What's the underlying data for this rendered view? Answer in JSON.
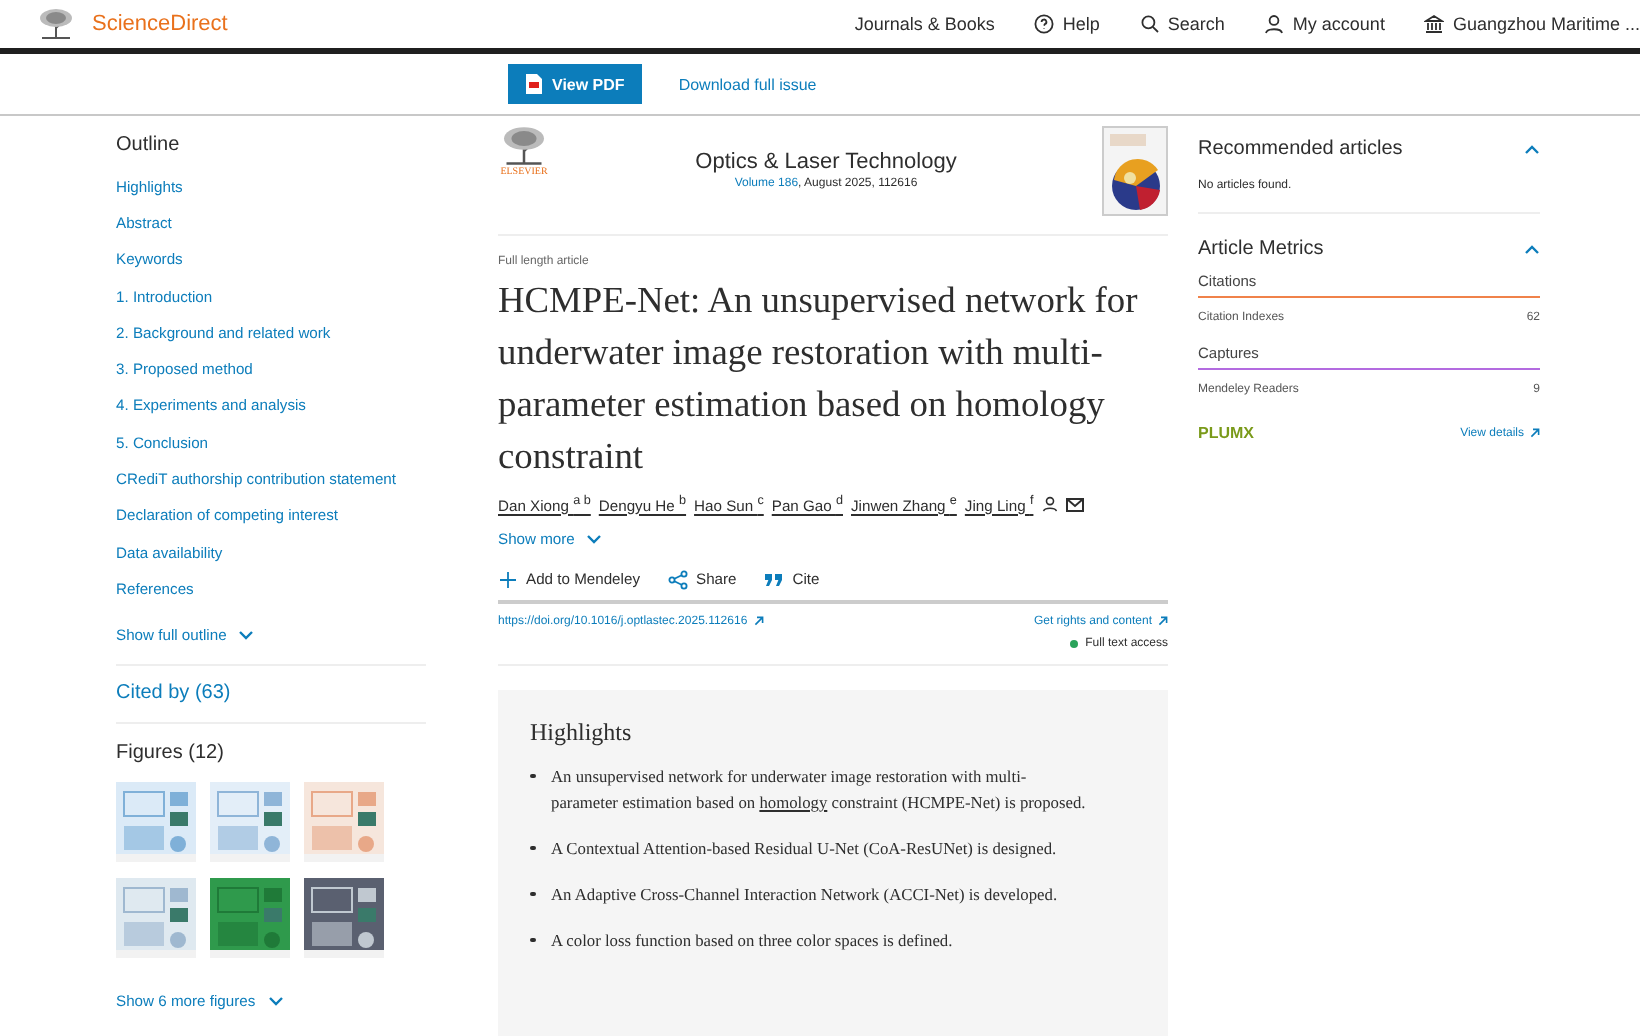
{
  "header": {
    "brand": "ScienceDirect",
    "nav": [
      {
        "kind": "text",
        "label": "Journals & Books"
      },
      {
        "kind": "help",
        "label": "Help"
      },
      {
        "kind": "search",
        "label": "Search"
      },
      {
        "kind": "account",
        "label": "My account"
      },
      {
        "kind": "institution",
        "label": "Guangzhou Maritime ..."
      }
    ]
  },
  "toolbar": {
    "view_pdf": "View PDF",
    "download": "Download full issue"
  },
  "outline": {
    "title": "Outline",
    "items": [
      "Highlights",
      "Abstract",
      "Keywords",
      "1. Introduction",
      "2. Background and related work",
      "3. Proposed method",
      "4. Experiments and analysis",
      "5. Conclusion",
      "CRediT authorship contribution statement",
      "Declaration of competing interest",
      "Data availability",
      "References"
    ],
    "show_full": "Show full outline"
  },
  "cited_by": "Cited by (63)",
  "figures": {
    "title": "Figures (12)",
    "show_more": "Show 6 more figures"
  },
  "journal": {
    "publisher": "ELSEVIER",
    "name": "Optics & Laser Technology",
    "volume_link": "Volume 186",
    "issue_info": ", August 2025, 112616"
  },
  "article": {
    "type": "Full length article",
    "title": "HCMPE-Net: An unsupervised network for underwater image restoration with multi-parameter estimation based on homology constraint",
    "authors": [
      {
        "name": "Dan Xiong",
        "sup": "a b"
      },
      {
        "name": "Dengyu He",
        "sup": "b"
      },
      {
        "name": "Hao Sun",
        "sup": "c"
      },
      {
        "name": "Pan Gao",
        "sup": "d"
      },
      {
        "name": "Jinwen Zhang",
        "sup": "e"
      },
      {
        "name": "Jing Ling",
        "sup": "f",
        "corresponding": true
      }
    ],
    "show_more": "Show more",
    "actions": [
      {
        "kind": "add",
        "label": "Add to Mendeley"
      },
      {
        "kind": "share",
        "label": "Share"
      },
      {
        "kind": "cite",
        "label": "Cite"
      }
    ],
    "doi": "https://doi.org/10.1016/j.optlastec.2025.112616",
    "rights": "Get rights and content",
    "access": "Full text access"
  },
  "highlights": {
    "title": "Highlights",
    "items": [
      {
        "before": "An unsupervised network for underwater image restoration with multi-parameter estimation based on ",
        "link": "homology",
        "after": " constraint (HCMPE-Net) is proposed."
      },
      {
        "before": "A Contextual Attention-based Residual U-Net (CoA-ResUNet) is designed."
      },
      {
        "before": "An Adaptive Cross-Channel Interaction Network (ACCI-Net) is developed."
      },
      {
        "before": "A color loss function based on three color spaces is defined."
      }
    ]
  },
  "recommended": {
    "title": "Recommended articles",
    "expanded": true,
    "message": "No articles found."
  },
  "metrics": {
    "title": "Article Metrics",
    "expanded": true,
    "groups": [
      {
        "name": "Citations",
        "color": "#f0824a",
        "rows": [
          {
            "label": "Citation Indexes",
            "value": "62"
          }
        ]
      },
      {
        "name": "Captures",
        "color": "#b36be0",
        "rows": [
          {
            "label": "Mendeley Readers",
            "value": "9"
          }
        ]
      }
    ],
    "brand": "PLUMX",
    "details": "View details"
  }
}
